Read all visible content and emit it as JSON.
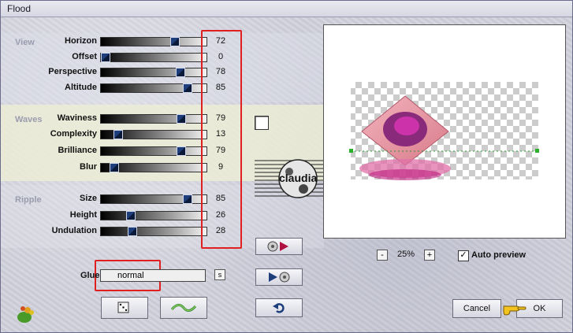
{
  "window": {
    "title": "Flood"
  },
  "sections": {
    "view": "View",
    "waves": "Waves",
    "ripple": "Ripple"
  },
  "sliders": [
    {
      "label": "Horizon",
      "value": "72",
      "fraction": 0.72
    },
    {
      "label": "Offset",
      "value": "0",
      "fraction": 0.0
    },
    {
      "label": "Perspective",
      "value": "78",
      "fraction": 0.78
    },
    {
      "label": "Altitude",
      "value": "85",
      "fraction": 0.85
    },
    {
      "label": "Waviness",
      "value": "79",
      "fraction": 0.79
    },
    {
      "label": "Complexity",
      "value": "13",
      "fraction": 0.13
    },
    {
      "label": "Brilliance",
      "value": "79",
      "fraction": 0.79
    },
    {
      "label": "Blur",
      "value": "9",
      "fraction": 0.09
    },
    {
      "label": "Size",
      "value": "85",
      "fraction": 0.85
    },
    {
      "label": "Height",
      "value": "26",
      "fraction": 0.26
    },
    {
      "label": "Undulation",
      "value": "28",
      "fraction": 0.28
    }
  ],
  "glue": {
    "label": "Glue",
    "value": "normal",
    "btn_label": "s"
  },
  "zoom": {
    "minus": "-",
    "value": "25%",
    "plus": "+"
  },
  "auto_preview": {
    "label": "Auto preview",
    "checked": true
  },
  "buttons": {
    "cancel": "Cancel",
    "ok": "OK"
  },
  "logo_text": "claudia",
  "colors": {
    "highlight": "#e02020",
    "accent": "#1d3e7a"
  }
}
